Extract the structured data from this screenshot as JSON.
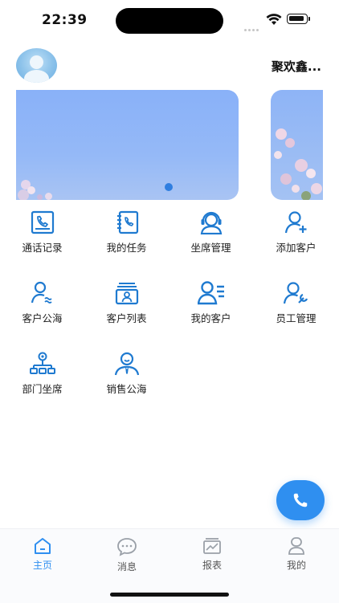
{
  "status_bar": {
    "time": "22:39"
  },
  "header": {
    "avatar_icon": "user-avatar-icon",
    "username": "聚欢鑫..."
  },
  "banner": {
    "slides": 2,
    "active_index": 0
  },
  "grid": {
    "items": [
      {
        "label": "通话记录",
        "icon": "call-record-icon"
      },
      {
        "label": "我的任务",
        "icon": "task-book-icon"
      },
      {
        "label": "坐席管理",
        "icon": "agent-headset-icon"
      },
      {
        "label": "添加客户",
        "icon": "add-customer-icon"
      },
      {
        "label": "客户公海",
        "icon": "customer-pool-icon"
      },
      {
        "label": "客户列表",
        "icon": "customer-list-icon"
      },
      {
        "label": "我的客户",
        "icon": "my-customers-icon"
      },
      {
        "label": "员工管理",
        "icon": "staff-manage-icon"
      },
      {
        "label": "部门坐席",
        "icon": "department-tree-icon"
      },
      {
        "label": "销售公海",
        "icon": "sales-person-icon"
      }
    ]
  },
  "fab": {
    "icon": "phone-icon"
  },
  "tabbar": {
    "tabs": [
      {
        "label": "主页",
        "icon": "home-icon",
        "active": true
      },
      {
        "label": "消息",
        "icon": "message-icon",
        "active": false
      },
      {
        "label": "报表",
        "icon": "report-icon",
        "active": false
      },
      {
        "label": "我的",
        "icon": "profile-icon",
        "active": false
      }
    ]
  },
  "colors": {
    "accent": "#2f8ff0",
    "icon_blue": "#1f7ad0",
    "banner": "#8fb5f7"
  }
}
